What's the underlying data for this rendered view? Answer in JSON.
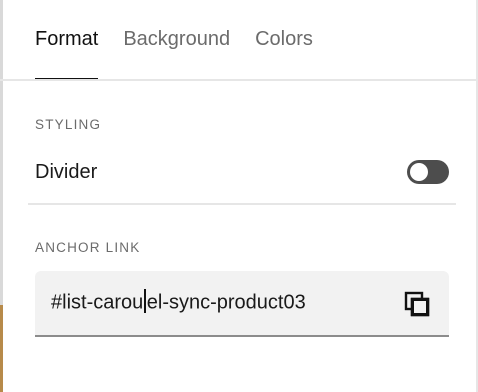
{
  "tabs": [
    {
      "label": "Format",
      "active": true
    },
    {
      "label": "Background",
      "active": false
    },
    {
      "label": "Colors",
      "active": false
    }
  ],
  "styling": {
    "section_label": "STYLING",
    "divider_label": "Divider",
    "divider_enabled": false
  },
  "anchor": {
    "section_label": "ANCHOR LINK",
    "value_before_caret": "#list-carou",
    "value_after_caret": "el-sync-product03",
    "copy_icon": "copy-icon"
  },
  "colors": {
    "active_tab": "#111111",
    "inactive_tab": "#6b6b6b",
    "toggle_track": "#4d4d4d",
    "field_background": "#f2f2f2"
  }
}
